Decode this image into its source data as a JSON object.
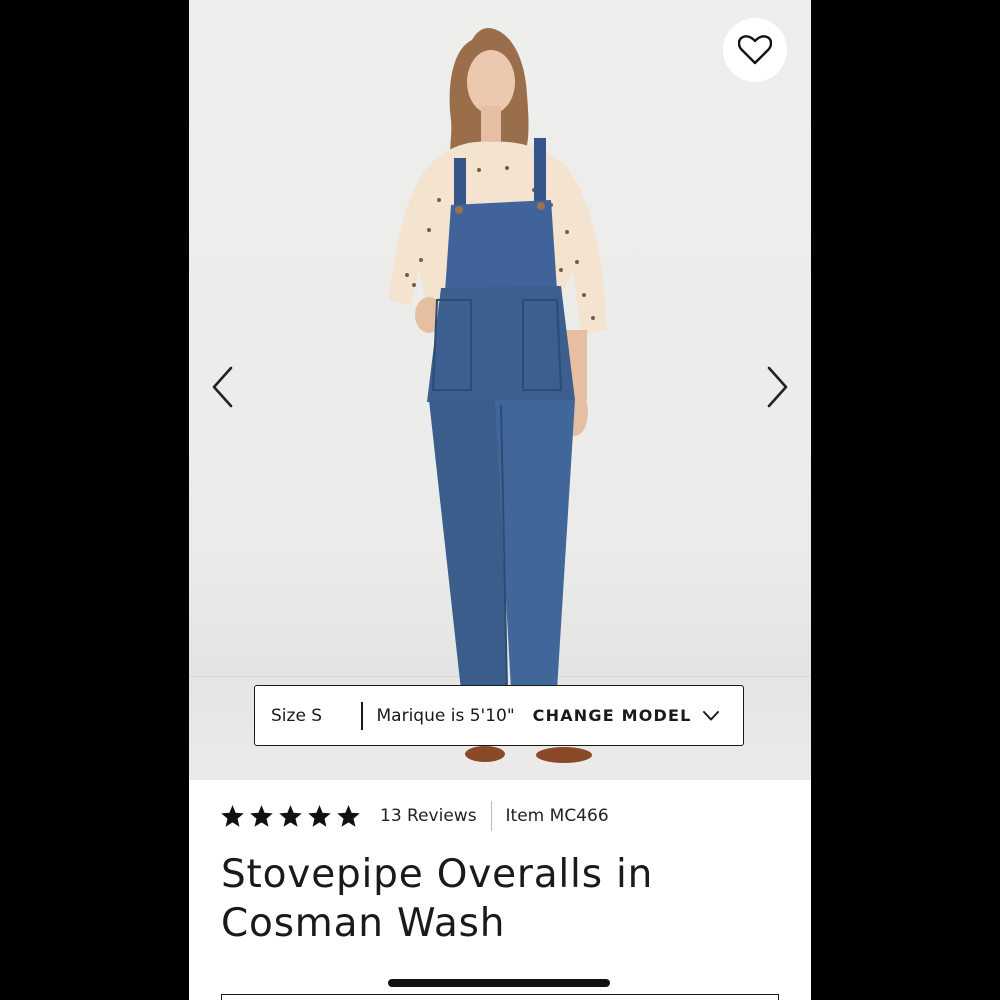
{
  "product": {
    "favorite_icon": "heart-outline-icon",
    "prev_icon": "chevron-left-icon",
    "next_icon": "chevron-right-icon",
    "model_info": {
      "size": "Size S",
      "height": "Marique is 5'10\"",
      "change_label": "CHANGE MODEL",
      "change_icon": "chevron-down-icon"
    },
    "rating": {
      "stars": 5,
      "max_stars": 5,
      "reviews": "13 Reviews",
      "star_icon": "star-icon"
    },
    "item_number": "Item MC466",
    "title": "Stovepipe Overalls in Cosman Wash"
  },
  "colors": {
    "background_frame": "#000000",
    "text": "#1a1a1a",
    "denim": "#3c5f8f",
    "blouse": "#f3e3cf"
  }
}
